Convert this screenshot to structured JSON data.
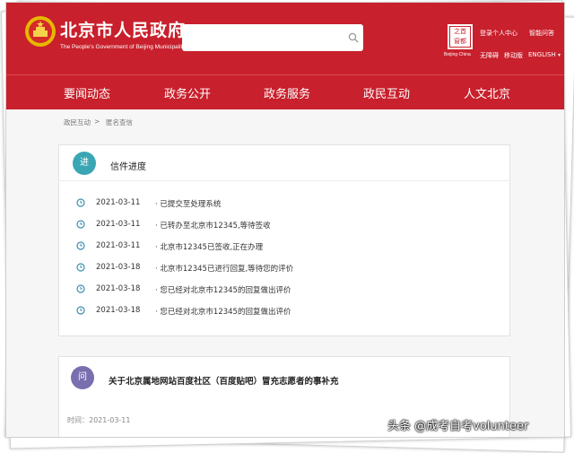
{
  "header": {
    "title": "北京市人民政府",
    "subtitle": "The People's Government of Beijing Municipality",
    "search_placeholder": "",
    "seal_chars": [
      "首",
      "之",
      "都",
      "窗"
    ],
    "seal_caption": "Beijing·China",
    "links": {
      "login": "登录个人中心",
      "assistant": "智能问答",
      "accessible": "无障碍",
      "mobile": "移动版",
      "english": "ENGLISH"
    }
  },
  "nav": {
    "items": [
      "要闻动态",
      "政务公开",
      "政务服务",
      "政民互动",
      "人文北京"
    ]
  },
  "breadcrumb": {
    "home": "政民互动",
    "separator": ">",
    "current": "匿名查信"
  },
  "progress_card": {
    "badge": "进",
    "title": "信件进度",
    "rows": [
      {
        "date": "2021-03-11",
        "text": "· 已提交至处理系统"
      },
      {
        "date": "2021-03-11",
        "text": "· 已转办至北京市12345,等待签收"
      },
      {
        "date": "2021-03-11",
        "text": "· 北京市12345已签收,正在办理"
      },
      {
        "date": "2021-03-18",
        "text": "· 北京市12345已进行回复,等待您的评价"
      },
      {
        "date": "2021-03-18",
        "text": "· 您已经对北京市12345的回复做出评价"
      },
      {
        "date": "2021-03-18",
        "text": "· 您已经对北京市12345的回复做出评价"
      }
    ]
  },
  "question_card": {
    "badge": "问",
    "title": "关于北京属地网站百度社区（百度贴吧）冒充志愿者的事补充",
    "time": "时间：2021-03-11"
  },
  "watermark": "头条 @成考自考volunteer",
  "colors": {
    "brand_red": "#c8202c",
    "progress_badge": "#3aa6b4",
    "question_badge": "#7a6fae",
    "timeline_icon": "#3a8fb0"
  }
}
